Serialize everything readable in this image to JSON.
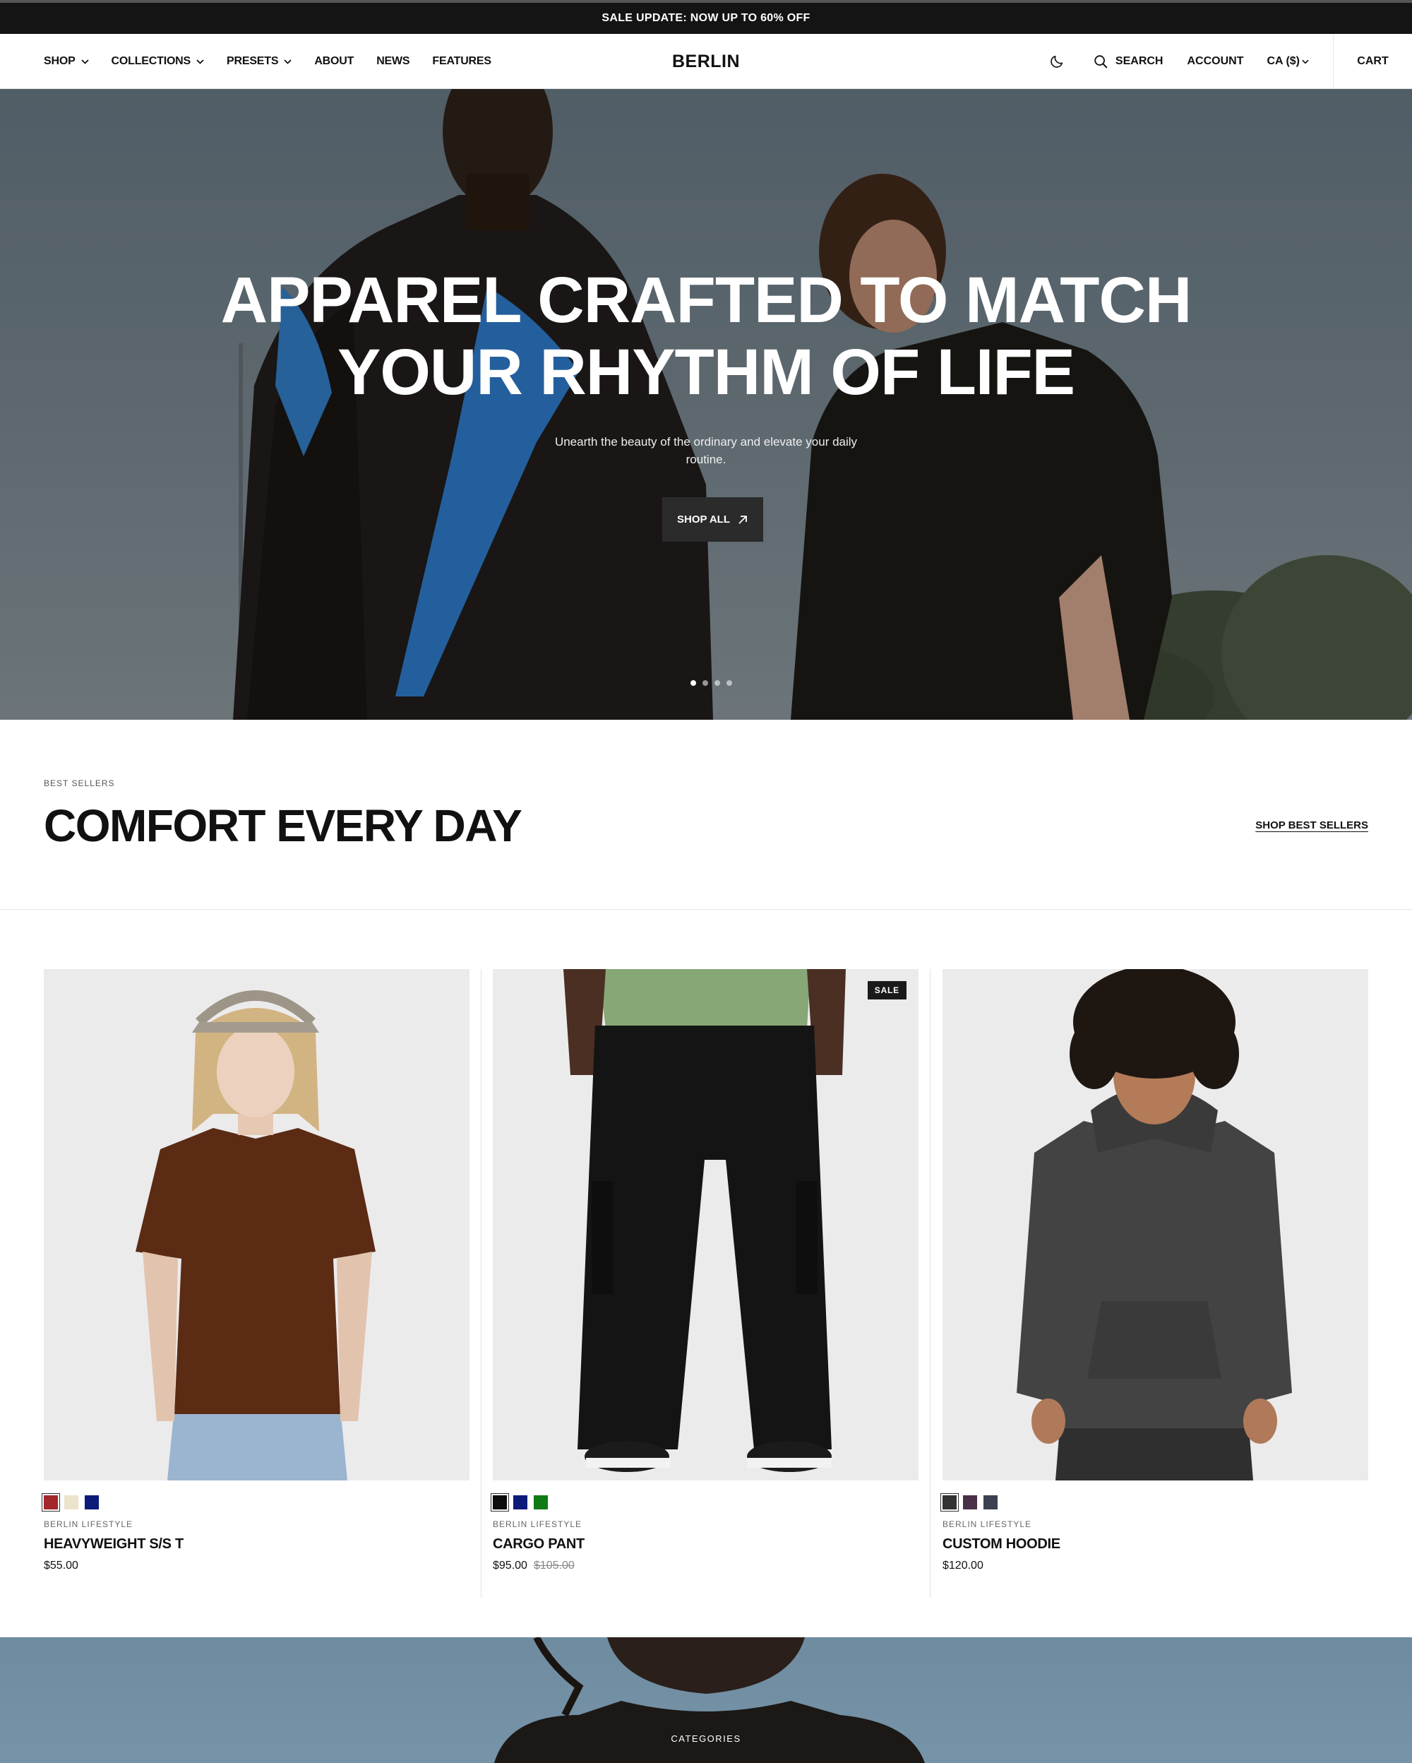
{
  "announcement": {
    "text": "SALE UPDATE: NOW UP TO 60% OFF"
  },
  "header": {
    "nav": [
      {
        "label": "SHOP",
        "has_dropdown": true
      },
      {
        "label": "COLLECTIONS",
        "has_dropdown": true
      },
      {
        "label": "PRESETS",
        "has_dropdown": true
      },
      {
        "label": "ABOUT",
        "has_dropdown": false
      },
      {
        "label": "NEWS",
        "has_dropdown": false
      },
      {
        "label": "FEATURES",
        "has_dropdown": false
      }
    ],
    "logo": "BERLIN",
    "theme_icon": "moon-icon",
    "search_label": "SEARCH",
    "account_label": "ACCOUNT",
    "currency_label": "CA ($)",
    "cart_label": "CART"
  },
  "hero": {
    "title_line1": "APPAREL CRAFTED TO MATCH",
    "title_line2": "YOUR RHYTHM OF LIFE",
    "subtitle": "Unearth the beauty of the ordinary and elevate your daily routine.",
    "cta_label": "SHOP ALL",
    "slides_total": 4,
    "active_slide": 1
  },
  "best_sellers": {
    "eyebrow": "BEST SELLERS",
    "title": "COMFORT EVERY DAY",
    "link_label": "SHOP BEST SELLERS",
    "products": [
      {
        "vendor": "BERLIN LIFESTYLE",
        "title": "HEAVYWEIGHT S/S T",
        "price": "$55.00",
        "compare_price": "",
        "badge": "",
        "swatches": [
          "#a3262a",
          "#ece3cc",
          "#0c1a7a"
        ],
        "selected_swatch": 0
      },
      {
        "vendor": "BERLIN LIFESTYLE",
        "title": "CARGO PANT",
        "price": "$95.00",
        "compare_price": "$105.00",
        "badge": "SALE",
        "swatches": [
          "#0d0d0d",
          "#0c1a7a",
          "#107a16"
        ],
        "selected_swatch": 0
      },
      {
        "vendor": "BERLIN LIFESTYLE",
        "title": "CUSTOM HOODIE",
        "price": "$120.00",
        "compare_price": "",
        "badge": "",
        "swatches": [
          "#333333",
          "#4a2f48",
          "#3c4150"
        ],
        "selected_swatch": 0
      }
    ]
  },
  "categories": {
    "eyebrow": "CATEGORIES"
  },
  "colors": {
    "announcement_bg": "#141414",
    "button_dark": "#2b2b2b",
    "product_bg": "#ecebec"
  }
}
